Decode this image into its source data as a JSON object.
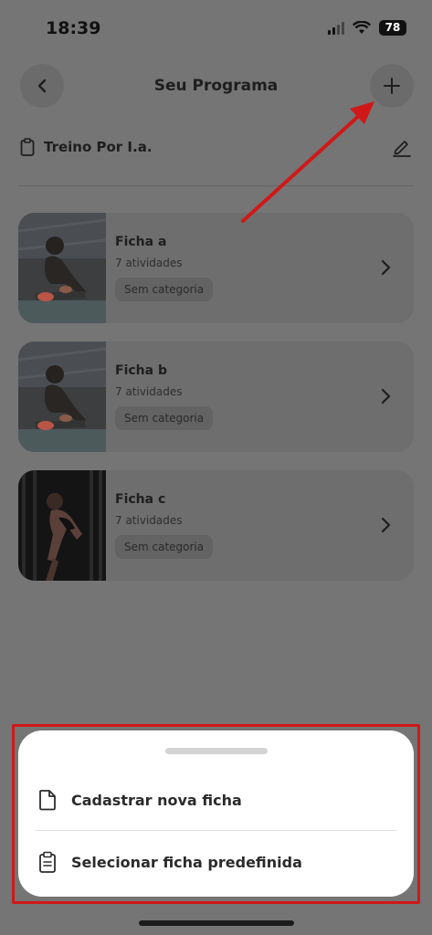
{
  "status_bar": {
    "time": "18:39",
    "battery": "78"
  },
  "header": {
    "title": "Seu Programa"
  },
  "program": {
    "name": "Treino Por I.a."
  },
  "cards": [
    {
      "title": "Ficha a",
      "subtitle": "7 atividades",
      "category": "Sem categoria"
    },
    {
      "title": "Ficha b",
      "subtitle": "7 atividades",
      "category": "Sem categoria"
    },
    {
      "title": "Ficha c",
      "subtitle": "7 atividades",
      "category": "Sem categoria"
    }
  ],
  "sheet": {
    "items": [
      {
        "label": "Cadastrar nova ficha",
        "icon": "document-icon"
      },
      {
        "label": "Selecionar ficha predefinida",
        "icon": "clipboard-icon"
      }
    ]
  },
  "colors": {
    "annotation": "#d01818",
    "overlay": "#757575"
  }
}
